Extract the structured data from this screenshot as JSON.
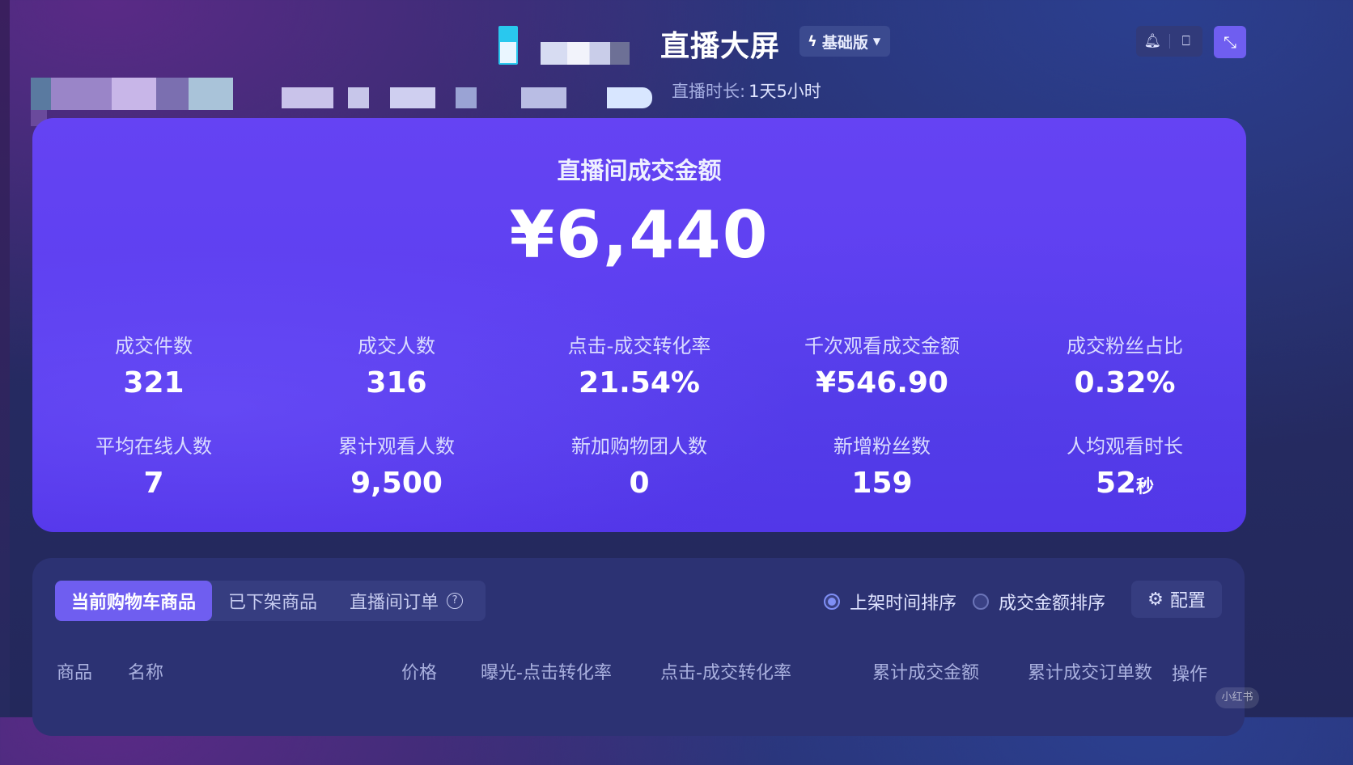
{
  "header": {
    "title": "直播大屏",
    "edition": "基础版",
    "duration_label": "直播时长:",
    "duration_value": "1天5小时",
    "icons": [
      "bell-icon",
      "monitor-icon",
      "fullscreen-icon"
    ]
  },
  "summary": {
    "title": "直播间成交金额",
    "amount": "¥6,440",
    "stats": [
      {
        "label": "成交件数",
        "value": "321"
      },
      {
        "label": "成交人数",
        "value": "316"
      },
      {
        "label": "点击-成交转化率",
        "value": "21.54%"
      },
      {
        "label": "千次观看成交金额",
        "value": "¥546.90"
      },
      {
        "label": "成交粉丝占比",
        "value": "0.32%"
      },
      {
        "label": "平均在线人数",
        "value": "7"
      },
      {
        "label": "累计观看人数",
        "value": "9,500"
      },
      {
        "label": "新加购物团人数",
        "value": "0"
      },
      {
        "label": "新增粉丝数",
        "value": "159"
      },
      {
        "label": "人均观看时长",
        "value": "52",
        "unit": "秒"
      }
    ]
  },
  "panel": {
    "tabs": [
      "当前购物车商品",
      "已下架商品",
      "直播间订单"
    ],
    "help_glyph": "?",
    "sort_options": [
      "上架时间排序",
      "成交金额排序"
    ],
    "config_label": "配置",
    "columns": [
      "商品",
      "名称",
      "价格",
      "曝光-点击转化率",
      "点击-成交转化率",
      "累计成交金额",
      "累计成交订单数",
      "操作"
    ]
  },
  "watermark": "小红书",
  "colors": {
    "accent": "#6f5ef0",
    "card": "#5c3ff0",
    "background": "#262b63"
  }
}
